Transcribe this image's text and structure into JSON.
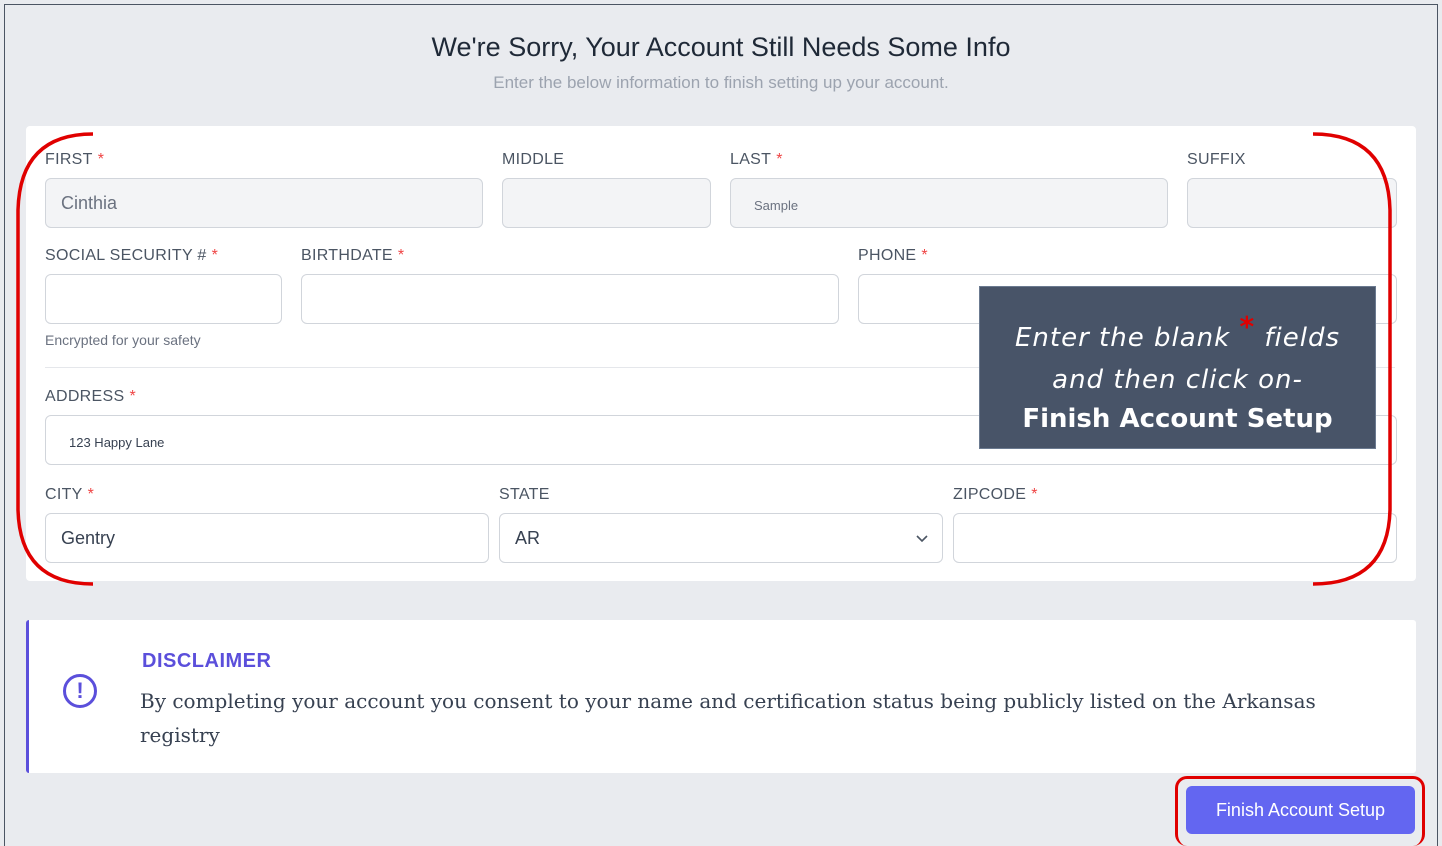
{
  "header": {
    "title": "We're Sorry, Your Account Still Needs Some Info",
    "subtitle": "Enter the below information to finish setting up your account."
  },
  "form": {
    "first": {
      "label": "FIRST",
      "required": "*",
      "value": "Cinthia"
    },
    "middle": {
      "label": "MIDDLE",
      "value": ""
    },
    "last": {
      "label": "LAST",
      "required": "*",
      "value": "Sample"
    },
    "suffix": {
      "label": "SUFFIX",
      "value": ""
    },
    "ssn": {
      "label": "SOCIAL SECURITY #",
      "required": "*",
      "value": "",
      "helper": "Encrypted for your safety"
    },
    "birthdate": {
      "label": "BIRTHDATE",
      "required": "*",
      "value": ""
    },
    "phone": {
      "label": "PHONE",
      "required": "*",
      "value": ""
    },
    "address": {
      "label": "ADDRESS",
      "required": "*",
      "value": "123 Happy Lane"
    },
    "city": {
      "label": "CITY",
      "required": "*",
      "value": "Gentry"
    },
    "state": {
      "label": "STATE",
      "value": "AR"
    },
    "zipcode": {
      "label": "ZIPCODE",
      "required": "*",
      "value": ""
    }
  },
  "callout": {
    "line1_a": "Enter the blank",
    "star": "*",
    "line1_b": "fields",
    "line2": "and then click on-",
    "line3": "Finish Account Setup"
  },
  "disclaimer": {
    "title": "DISCLAIMER",
    "icon_glyph": "!",
    "body": "By completing your account you consent to your name and certification status being publicly listed on the Arkansas registry"
  },
  "actions": {
    "finish_label": "Finish Account Setup"
  },
  "colors": {
    "accent": "#6366f1",
    "disclaimer_accent": "#5b4fdb",
    "required": "#ef4444",
    "annotation_red": "#e00000",
    "callout_bg": "#485468"
  }
}
